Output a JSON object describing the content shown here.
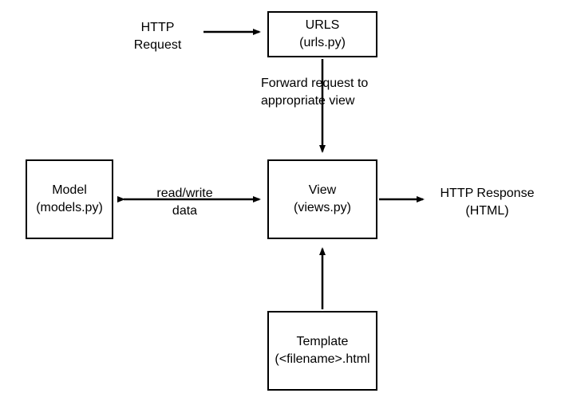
{
  "boxes": {
    "urls": {
      "line1": "URLS",
      "line2": "(urls.py)"
    },
    "view": {
      "line1": "View",
      "line2": "(views.py)"
    },
    "model": {
      "line1": "Model",
      "line2": "(models.py)"
    },
    "template": {
      "line1": "Template",
      "line2": "(<filename>.html"
    }
  },
  "labels": {
    "http_request": {
      "line1": "HTTP",
      "line2": "Request"
    },
    "forward": {
      "line1": "Forward request to",
      "line2": "appropriate view"
    },
    "readwrite": {
      "line1": "read/write",
      "line2": "data"
    },
    "http_response": {
      "line1": "HTTP Response",
      "line2": "(HTML)"
    }
  }
}
